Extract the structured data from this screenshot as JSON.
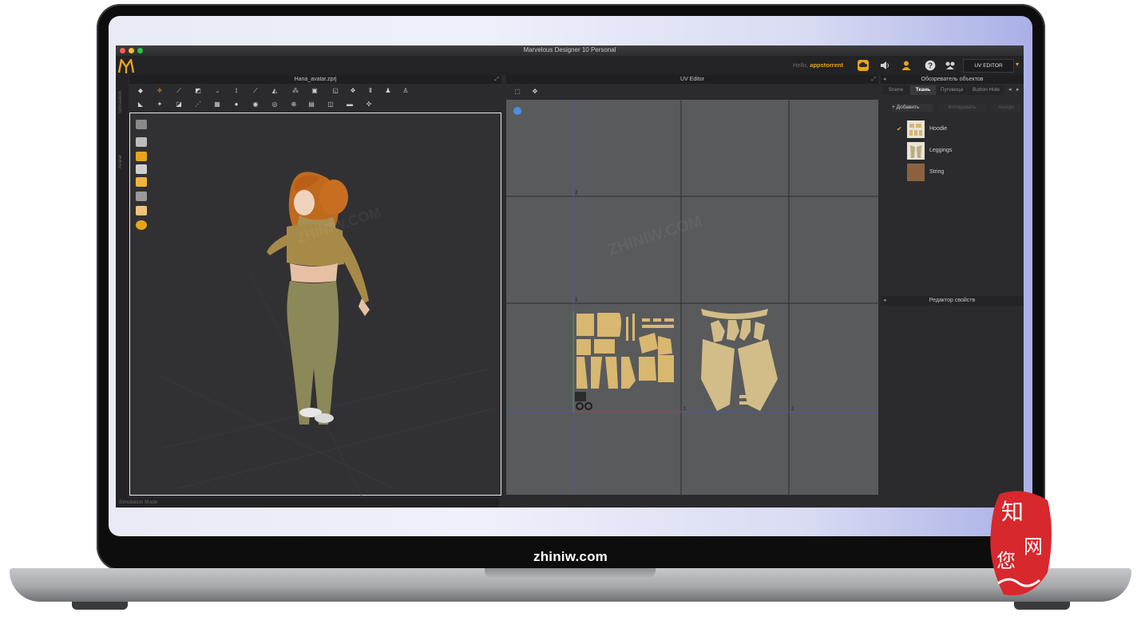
{
  "app": {
    "window_title": "Marvelous Designer 10 Personal",
    "user_prefix": "Hello,",
    "user_name": "appstorrent",
    "mode_button": "UV EDITOR",
    "left_strip_top": "Simulation",
    "left_strip_bottom": "Avatar"
  },
  "viewport3d": {
    "file_title": "Hana_avatar.zprj",
    "status": "Simulation Mode"
  },
  "uv_editor": {
    "title": "UV Editor",
    "grid_labels": [
      "2",
      "1",
      "1",
      "2"
    ]
  },
  "object_browser": {
    "title": "Обозреватель объектов",
    "tabs": [
      "Scene",
      "Ткань",
      "Пуговица",
      "Button Hole"
    ],
    "active_tab": "Ткань",
    "add_label": "+ Добавить",
    "copy_label": "Копировать",
    "assign_label": "Assign",
    "items": [
      {
        "label": "Hoodie",
        "checked": true
      },
      {
        "label": "Leggings",
        "checked": false
      },
      {
        "label": "String",
        "checked": false
      }
    ]
  },
  "property_editor": {
    "title": "Редактор свойств"
  },
  "page": {
    "footer_text": "zhiniw.com",
    "watermark": "ZHINIW.COM",
    "badge_chars": [
      "知",
      "网",
      "您"
    ]
  },
  "colors": {
    "accent": "#e8a41b",
    "fabric": "#d2bd88",
    "hoodie_fabric": "#d8b771",
    "uv_background": "#595a5c",
    "string_swatch": "#8b6240"
  }
}
